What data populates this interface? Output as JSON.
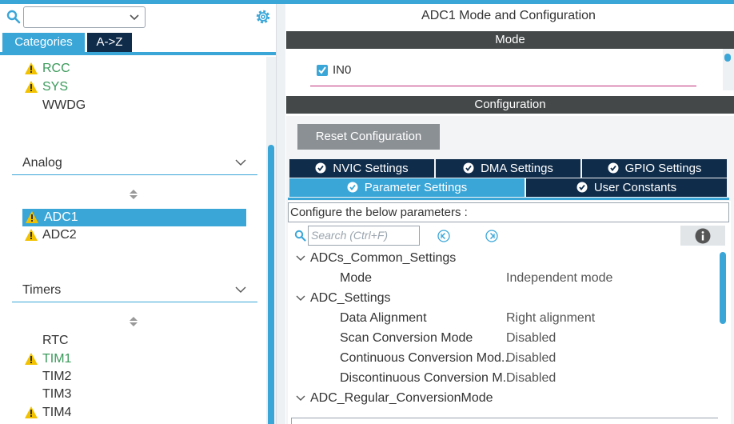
{
  "left": {
    "search_icon": "search-icon",
    "combo_value": "",
    "settings_icon": "gear-icon",
    "tabs": {
      "categories": "Categories",
      "az": "A->Z"
    },
    "system_items": [
      {
        "label": "RCC",
        "warning": true,
        "color": "#3a9a5a"
      },
      {
        "label": "SYS",
        "warning": true,
        "color": "#3a9a5a"
      },
      {
        "label": "WWDG",
        "warning": false,
        "color": "#333333"
      }
    ],
    "analog": {
      "title": "Analog",
      "items": [
        {
          "label": "ADC1",
          "warning": true,
          "selected": true
        },
        {
          "label": "ADC2",
          "warning": true,
          "selected": false
        }
      ]
    },
    "timers": {
      "title": "Timers",
      "items": [
        {
          "label": "RTC",
          "warning": false
        },
        {
          "label": "TIM1",
          "warning": true
        },
        {
          "label": "TIM2",
          "warning": false
        },
        {
          "label": "TIM3",
          "warning": false
        },
        {
          "label": "TIM4",
          "warning": true
        }
      ]
    }
  },
  "right": {
    "title": "ADC1 Mode and Configuration",
    "mode_header": "Mode",
    "mode_checkbox": {
      "label": "IN0",
      "checked": true
    },
    "config_header": "Configuration",
    "reset_button": "Reset Configuration",
    "tabs": [
      {
        "label": "NVIC Settings",
        "active": false
      },
      {
        "label": "DMA Settings",
        "active": false
      },
      {
        "label": "GPIO Settings",
        "active": false
      },
      {
        "label": "Parameter Settings",
        "active": true
      },
      {
        "label": "User Constants",
        "active": false
      }
    ],
    "configure_label": "Configure the below parameters :",
    "search_placeholder": "Search (Ctrl+F)",
    "params": {
      "common_group": "ADCs_Common_Settings",
      "mode_name": "Mode",
      "mode_value": "Independent mode",
      "adc_group": "ADC_Settings",
      "align_name": "Data Alignment",
      "align_value": "Right alignment",
      "scan_name": "Scan Conversion Mode",
      "scan_value": "Disabled",
      "cont_name": "Continuous Conversion Mod..",
      "cont_value": "Disabled",
      "disc_name": "Discontinuous Conversion M..",
      "disc_value": "Disabled",
      "regular_group": "ADC_Regular_ConversionMode"
    }
  },
  "colors": {
    "accent": "#3aa6d8",
    "navy": "#0f2c4a",
    "header_dark": "#444849",
    "warning": "#f2c200",
    "enabled_green": "#3a9a5a"
  }
}
